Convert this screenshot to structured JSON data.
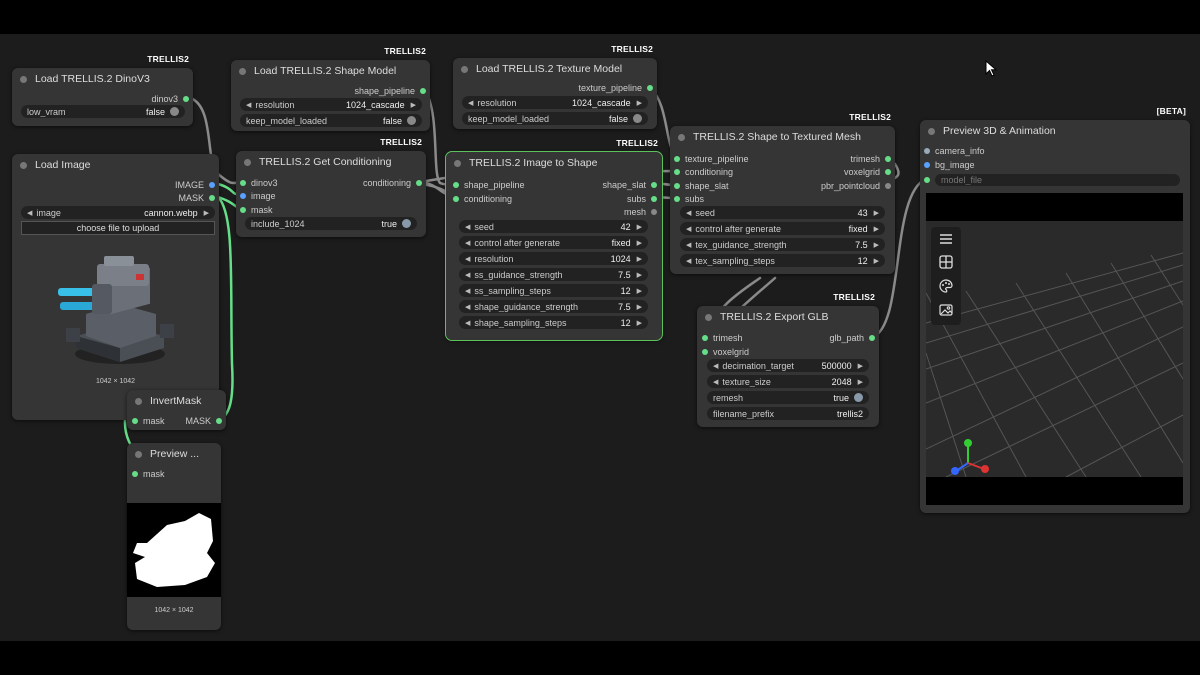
{
  "badges": {
    "trellis": "TRELLIS2",
    "beta": "[BETA]"
  },
  "dinov3": {
    "title": "Load TRELLIS.2 DinoV3",
    "output": "dinov3",
    "low_vram_label": "low_vram",
    "low_vram_value": "false"
  },
  "load_image": {
    "title": "Load Image",
    "outputs": [
      "IMAGE",
      "MASK"
    ],
    "image_label": "image",
    "image_value": "cannon.webp",
    "upload_label": "choose file to upload",
    "dims": "1042 × 1042"
  },
  "invert_mask": {
    "title": "InvertMask",
    "input": "mask",
    "output": "MASK"
  },
  "preview_mask": {
    "title": "Preview ...",
    "input": "mask",
    "dims": "1042 × 1042"
  },
  "shape_model": {
    "title": "Load TRELLIS.2 Shape Model",
    "output": "shape_pipeline",
    "resolution_label": "resolution",
    "resolution_value": "1024_cascade",
    "keep_label": "keep_model_loaded",
    "keep_value": "false"
  },
  "conditioning": {
    "title": "TRELLIS.2 Get Conditioning",
    "inputs": [
      "dinov3",
      "image",
      "mask"
    ],
    "output": "conditioning",
    "include_label": "include_1024",
    "include_value": "true"
  },
  "texture_model": {
    "title": "Load TRELLIS.2 Texture Model",
    "output": "texture_pipeline",
    "resolution_label": "resolution",
    "resolution_value": "1024_cascade",
    "keep_label": "keep_model_loaded",
    "keep_value": "false"
  },
  "image_to_shape": {
    "title": "TRELLIS.2 Image to Shape",
    "inputs": [
      "shape_pipeline",
      "conditioning"
    ],
    "outputs": [
      "shape_slat",
      "subs",
      "mesh"
    ],
    "widgets": [
      {
        "label": "seed",
        "value": "42"
      },
      {
        "label": "control after generate",
        "value": "fixed"
      },
      {
        "label": "resolution",
        "value": "1024"
      },
      {
        "label": "ss_guidance_strength",
        "value": "7.5"
      },
      {
        "label": "ss_sampling_steps",
        "value": "12"
      },
      {
        "label": "shape_guidance_strength",
        "value": "7.5"
      },
      {
        "label": "shape_sampling_steps",
        "value": "12"
      }
    ]
  },
  "textured_mesh": {
    "title": "TRELLIS.2 Shape to Textured Mesh",
    "inputs": [
      "texture_pipeline",
      "conditioning",
      "shape_slat",
      "subs"
    ],
    "outputs": [
      "trimesh",
      "voxelgrid",
      "pbr_pointcloud"
    ],
    "widgets": [
      {
        "label": "seed",
        "value": "43"
      },
      {
        "label": "control after generate",
        "value": "fixed"
      },
      {
        "label": "tex_guidance_strength",
        "value": "7.5"
      },
      {
        "label": "tex_sampling_steps",
        "value": "12"
      }
    ]
  },
  "export_glb": {
    "title": "TRELLIS.2 Export GLB",
    "inputs": [
      "trimesh",
      "voxelgrid"
    ],
    "output": "glb_path",
    "widgets": [
      {
        "label": "decimation_target",
        "value": "500000"
      },
      {
        "label": "texture_size",
        "value": "2048"
      },
      {
        "label": "remesh",
        "value": "true"
      },
      {
        "label": "filename_prefix",
        "value": "trellis2"
      }
    ]
  },
  "preview3d": {
    "title": "Preview 3D & Animation",
    "inputs": [
      "camera_info",
      "bg_image"
    ],
    "model_file_label": "model_file"
  },
  "colors": {
    "link": "#66dd88",
    "selected": "#5cc35c",
    "node": "#353535",
    "canvas": "#1c1c1c"
  }
}
